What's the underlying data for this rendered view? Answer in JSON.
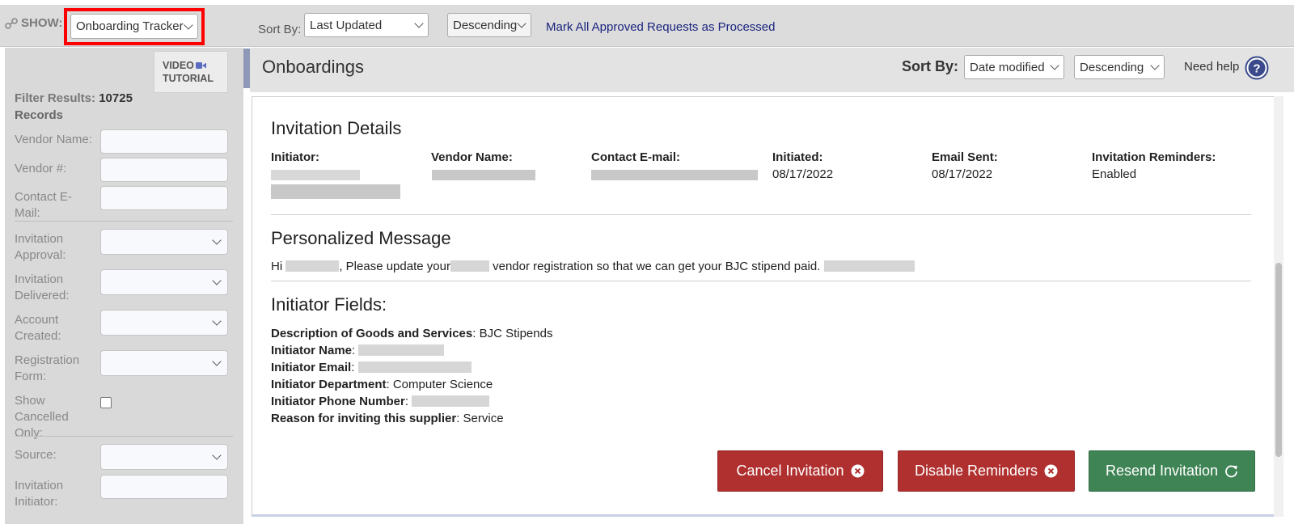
{
  "topbar": {
    "show_label": "SHOW:",
    "show_select": "Onboarding Tracker",
    "sort_label": "Sort By:",
    "sort_select": "Last Updated",
    "order_select": "Descending",
    "mark_link": "Mark All Approved Requests as Processed"
  },
  "sidebar": {
    "video_line1": "VIDEO",
    "video_line2": "TUTORIAL",
    "filter_label": "Filter Results:",
    "filter_count": "10725",
    "filter_records": "Records",
    "fields": {
      "vendor_name": "Vendor Name:",
      "vendor_num": "Vendor #:",
      "contact_email": "Contact E-Mail:",
      "invitation_approval": "Invitation Approval:",
      "invitation_delivered": "Invitation Delivered:",
      "account_created": "Account Created:",
      "registration_form": "Registration Form:",
      "show_cancelled": "Show Cancelled Only:",
      "source": "Source:",
      "invitation_initiator": "Invitation Initiator:"
    }
  },
  "main": {
    "title": "Onboardings",
    "sort_label": "Sort By:",
    "sort_select": "Date modified",
    "order_select": "Descending",
    "need_help": "Need help",
    "invitation": {
      "heading": "Invitation Details",
      "initiator_label": "Initiator:",
      "vendor_label": "Vendor Name:",
      "contact_label": "Contact E-mail:",
      "initiated_label": "Initiated:",
      "initiated_value": "08/17/2022",
      "email_sent_label": "Email Sent:",
      "email_sent_value": "08/17/2022",
      "reminders_label": "Invitation Reminders:",
      "reminders_value": "Enabled"
    },
    "message": {
      "heading": "Personalized Message",
      "part1": "Hi",
      "part2": ", Please update your",
      "part3": "vendor registration so that we can get your BJC stipend paid."
    },
    "initiator_fields": {
      "heading": "Initiator Fields:",
      "goods_label": "Description of Goods and Services",
      "goods_value": ": BJC Stipends",
      "name_label": "Initiator Name",
      "email_label": "Initiator Email",
      "dept_label": "Initiator Department",
      "dept_value": ": Computer Science",
      "phone_label": "Initiator Phone Number",
      "reason_label": "Reason for inviting this supplier",
      "reason_value": ": Service",
      "colon": ":"
    },
    "buttons": {
      "cancel": "Cancel Invitation",
      "disable": "Disable Reminders",
      "resend": "Resend Invitation"
    }
  },
  "colors": {
    "danger": "#b03030",
    "success": "#3f8454",
    "link": "#1a237e",
    "highlight": "#ff0000"
  }
}
